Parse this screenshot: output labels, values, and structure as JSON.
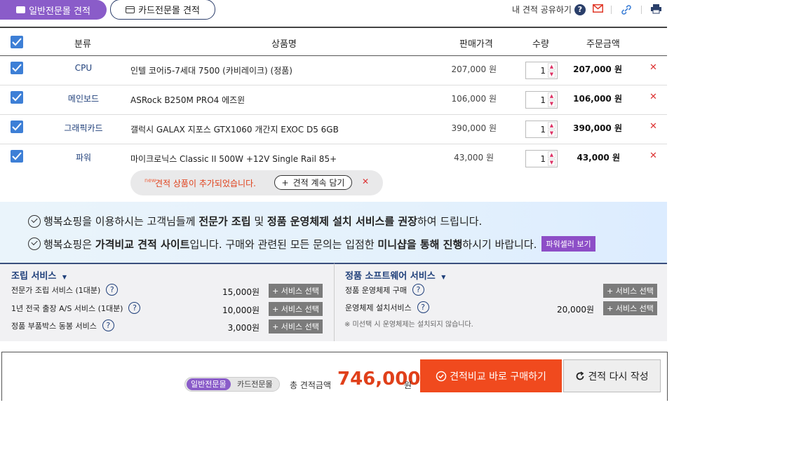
{
  "tabs": {
    "general": "일반전문몰 견적",
    "card": "카드전문몰 견적"
  },
  "share": {
    "label": "내 견적 공유하기",
    "help": "?"
  },
  "icons": [
    "help-icon",
    "mail-icon",
    "link-icon",
    "print-icon"
  ],
  "table": {
    "headers": {
      "category": "분류",
      "product": "상품명",
      "price": "판매가격",
      "qty": "수량",
      "amount": "주문금액"
    },
    "rows": [
      {
        "category": "CPU",
        "product": "인텔 코어i5-7세대 7500 (카비레이크) (정품)",
        "price": "207,000 원",
        "qty": "1",
        "amount": "207,000 원"
      },
      {
        "category": "메인보드",
        "product": "ASRock B250M PRO4 에즈윈",
        "price": "106,000 원",
        "qty": "1",
        "amount": "106,000 원"
      },
      {
        "category": "그래픽카드",
        "product": "갤럭시 GALAX 지포스 GTX1060 개간지 EXOC D5 6GB",
        "price": "390,000 원",
        "qty": "1",
        "amount": "390,000 원"
      },
      {
        "category": "파워",
        "product": "마이크로닉스 Classic II 500W +12V Single Rail 85+",
        "price": "43,000 원",
        "qty": "1",
        "amount": "43,000 원"
      }
    ]
  },
  "notice": {
    "new": "new",
    "text": "견적 상품이 추가되었습니다.",
    "button": "견적 계속 담기",
    "button_prefix": "+"
  },
  "info": {
    "line1": {
      "a": "행복쇼핑을 이용하시는 고객님들께 ",
      "b": "전문가 조립",
      "c": " 및 ",
      "d": "정품 운영체제 설치 서비스를 권장",
      "e": "하여 드립니다."
    },
    "line2": {
      "a": "행복쇼핑은 ",
      "b": "가격비교 견적 사이트",
      "c": "입니다. 구매와 관련된 모든 문의는 입점한 ",
      "d": "미니샵을 통해 진행",
      "e": "하시기 바랍니다.",
      "button": "파워셀러 보기"
    }
  },
  "services": {
    "assembly": {
      "title": "조립 서비스",
      "items": [
        {
          "label": "전문가 조립 서비스 (1대분)",
          "price": "15,000원",
          "button": "+ 서비스 선택"
        },
        {
          "label": "1년 전국 출장 A/S 서비스 (1대분)",
          "price": "10,000원",
          "button": "+ 서비스 선택"
        },
        {
          "label": "정품 부품박스 동봉 서비스",
          "price": "3,000원",
          "button": "+ 서비스 선택"
        }
      ]
    },
    "software": {
      "title": "정품 소프트웨어 서비스",
      "items": [
        {
          "label": "정품 운영체제 구매",
          "price": "",
          "button": "+ 서비스 선택"
        },
        {
          "label": "운영체제 설치서비스",
          "price": "20,000원",
          "button": "+ 서비스 선택"
        }
      ],
      "note": "※ 미선택 시 운영체제는 설치되지 않습니다."
    }
  },
  "total": {
    "mode_general": "일반전문몰",
    "mode_card": "카드전문몰",
    "label": "총 견적금액",
    "value": "746,000",
    "unit": "원",
    "buy_button": "견적비교 바로 구매하기",
    "redo_button": "견적 다시 작성"
  },
  "colors": {
    "accent_purple": "#8a5cc9",
    "navy": "#1f3f7a",
    "checkbox_blue": "#3d7fd6",
    "buy_orange": "#f04a1e"
  }
}
